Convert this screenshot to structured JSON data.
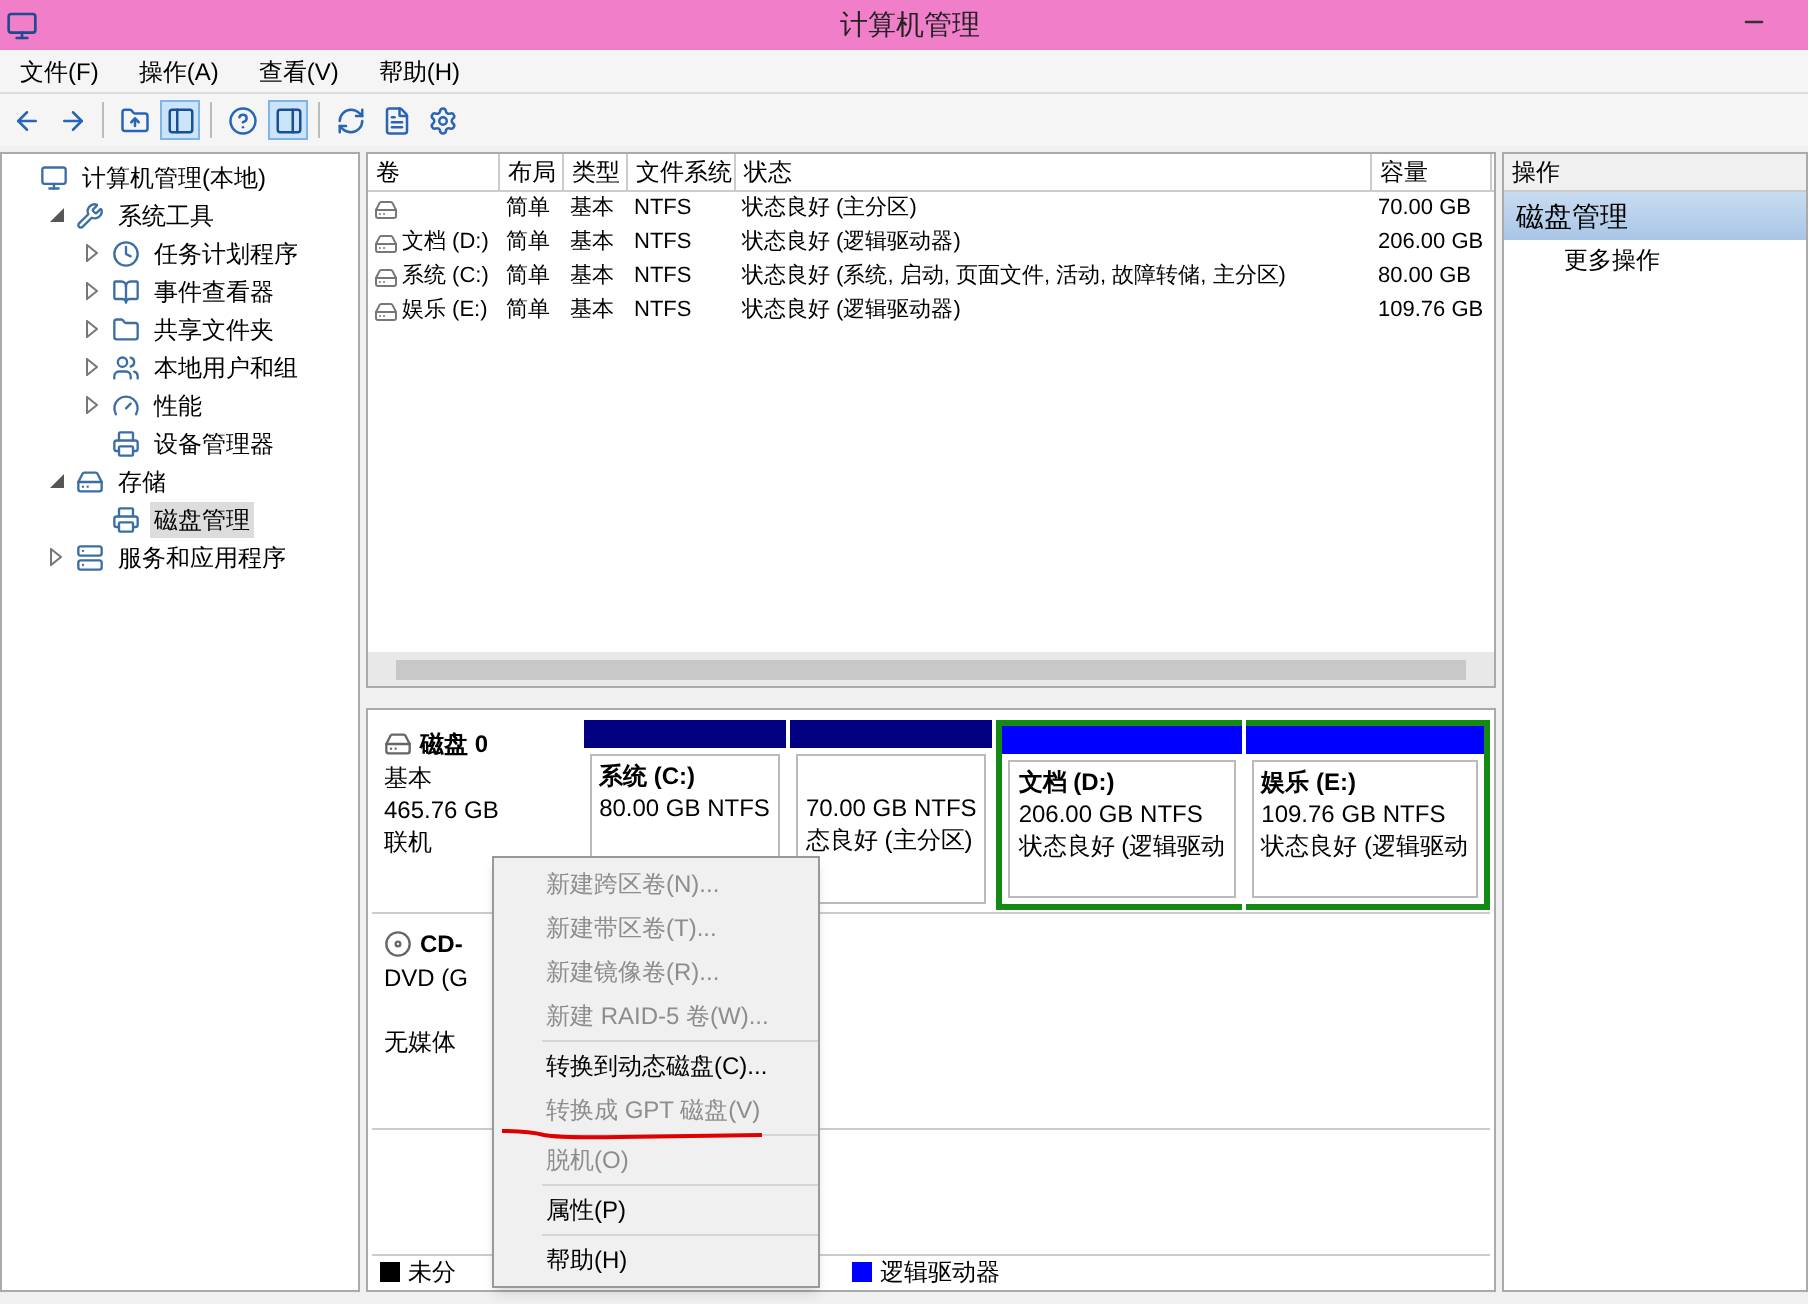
{
  "window": {
    "title": "计算机管理"
  },
  "menu_bar": [
    "文件(F)",
    "操作(A)",
    "查看(V)",
    "帮助(H)"
  ],
  "toolbar": [
    [
      {
        "kind": "back",
        "pressed": false
      },
      {
        "kind": "forward",
        "pressed": false
      }
    ],
    [
      {
        "kind": "up",
        "pressed": false
      },
      {
        "kind": "tree",
        "pressed": true
      }
    ],
    [
      {
        "kind": "help",
        "pressed": false
      },
      {
        "kind": "pane",
        "pressed": true
      }
    ],
    [
      {
        "kind": "refresh",
        "pressed": false
      },
      {
        "kind": "properties",
        "pressed": false
      },
      {
        "kind": "settings",
        "pressed": false
      }
    ]
  ],
  "tree": [
    {
      "label": "计算机管理(本地)",
      "kind": "computer",
      "selected": false,
      "children": [
        {
          "label": "系统工具",
          "kind": "tools",
          "expanded": true,
          "selected": false,
          "children": [
            {
              "label": "任务计划程序",
              "kind": "clock",
              "expanded": false,
              "selected": false
            },
            {
              "label": "事件查看器",
              "kind": "log",
              "expanded": false,
              "selected": false
            },
            {
              "label": "共享文件夹",
              "kind": "folder",
              "expanded": false,
              "selected": false
            },
            {
              "label": "本地用户和组",
              "kind": "users",
              "expanded": false,
              "selected": false
            },
            {
              "label": "性能",
              "kind": "gauge",
              "expanded": false,
              "selected": false
            },
            {
              "label": "设备管理器",
              "kind": "device",
              "selected": false
            }
          ]
        },
        {
          "label": "存储",
          "kind": "storage",
          "expanded": true,
          "selected": false,
          "children": [
            {
              "label": "磁盘管理",
              "kind": "device",
              "selected": true
            }
          ]
        },
        {
          "label": "服务和应用程序",
          "kind": "server",
          "expanded": false,
          "selected": false
        }
      ]
    }
  ],
  "table": {
    "columns": [
      "卷",
      "布局",
      "类型",
      "文件系统",
      "状态",
      "容量"
    ],
    "rows": [
      [
        "",
        "简单",
        "基本",
        "NTFS",
        "状态良好 (主分区)",
        "70.00 GB"
      ],
      [
        "文档 (D:)",
        "简单",
        "基本",
        "NTFS",
        "状态良好 (逻辑驱动器)",
        "206.00 GB"
      ],
      [
        "系统 (C:)",
        "简单",
        "基本",
        "NTFS",
        "状态良好 (系统, 启动, 页面文件, 活动, 故障转储, 主分区)",
        "80.00 GB"
      ],
      [
        "娱乐 (E:)",
        "简单",
        "基本",
        "NTFS",
        "状态良好 (逻辑驱动器)",
        "109.76 GB"
      ]
    ]
  },
  "disks": [
    {
      "kind": "disk",
      "name": "磁盘 0",
      "lines": [
        "基本",
        "465.76 GB",
        "联机"
      ],
      "partitions": [
        {
          "kind": "primary",
          "name": "系统 (C:)",
          "lines": [
            "80.00 GB NTFS"
          ],
          "selected": false
        },
        {
          "kind": "primary",
          "lines": [
            "70.00 GB NTFS",
            "态良好 (主分区)"
          ],
          "selected": false
        },
        {
          "kind": "logical",
          "name": "文档 (D:)",
          "lines": [
            "206.00 GB NTFS",
            "状态良好 (逻辑驱动"
          ],
          "selected": true
        },
        {
          "kind": "logical",
          "name": "娱乐 (E:)",
          "lines": [
            "109.76 GB NTFS",
            "状态良好 (逻辑驱动"
          ],
          "selected": true
        }
      ]
    },
    {
      "kind": "cd",
      "name": "CD-",
      "lines": [
        "DVD (G",
        "无媒体"
      ]
    }
  ],
  "legend": [
    {
      "label": "未分",
      "color": "#000000"
    },
    {
      "label": "逻辑驱动器",
      "color": "#0000ff"
    }
  ],
  "context_menu": [
    [
      {
        "label": "新建跨区卷(N)...",
        "disabled": true
      },
      {
        "label": "新建带区卷(T)...",
        "disabled": true
      },
      {
        "label": "新建镜像卷(R)...",
        "disabled": true
      },
      {
        "label": "新建 RAID-5 卷(W)...",
        "disabled": true
      }
    ],
    [
      {
        "label": "转换到动态磁盘(C)...",
        "disabled": false
      },
      {
        "label": "转换成 GPT 磁盘(V)",
        "disabled": true,
        "underlined": true
      }
    ],
    [
      {
        "label": "脱机(O)",
        "disabled": true
      }
    ],
    [
      {
        "label": "属性(P)",
        "disabled": false
      }
    ],
    [
      {
        "label": "帮助(H)",
        "disabled": false
      }
    ]
  ],
  "actions": {
    "title": "操作",
    "section": "磁盘管理",
    "items": [
      "更多操作"
    ]
  }
}
